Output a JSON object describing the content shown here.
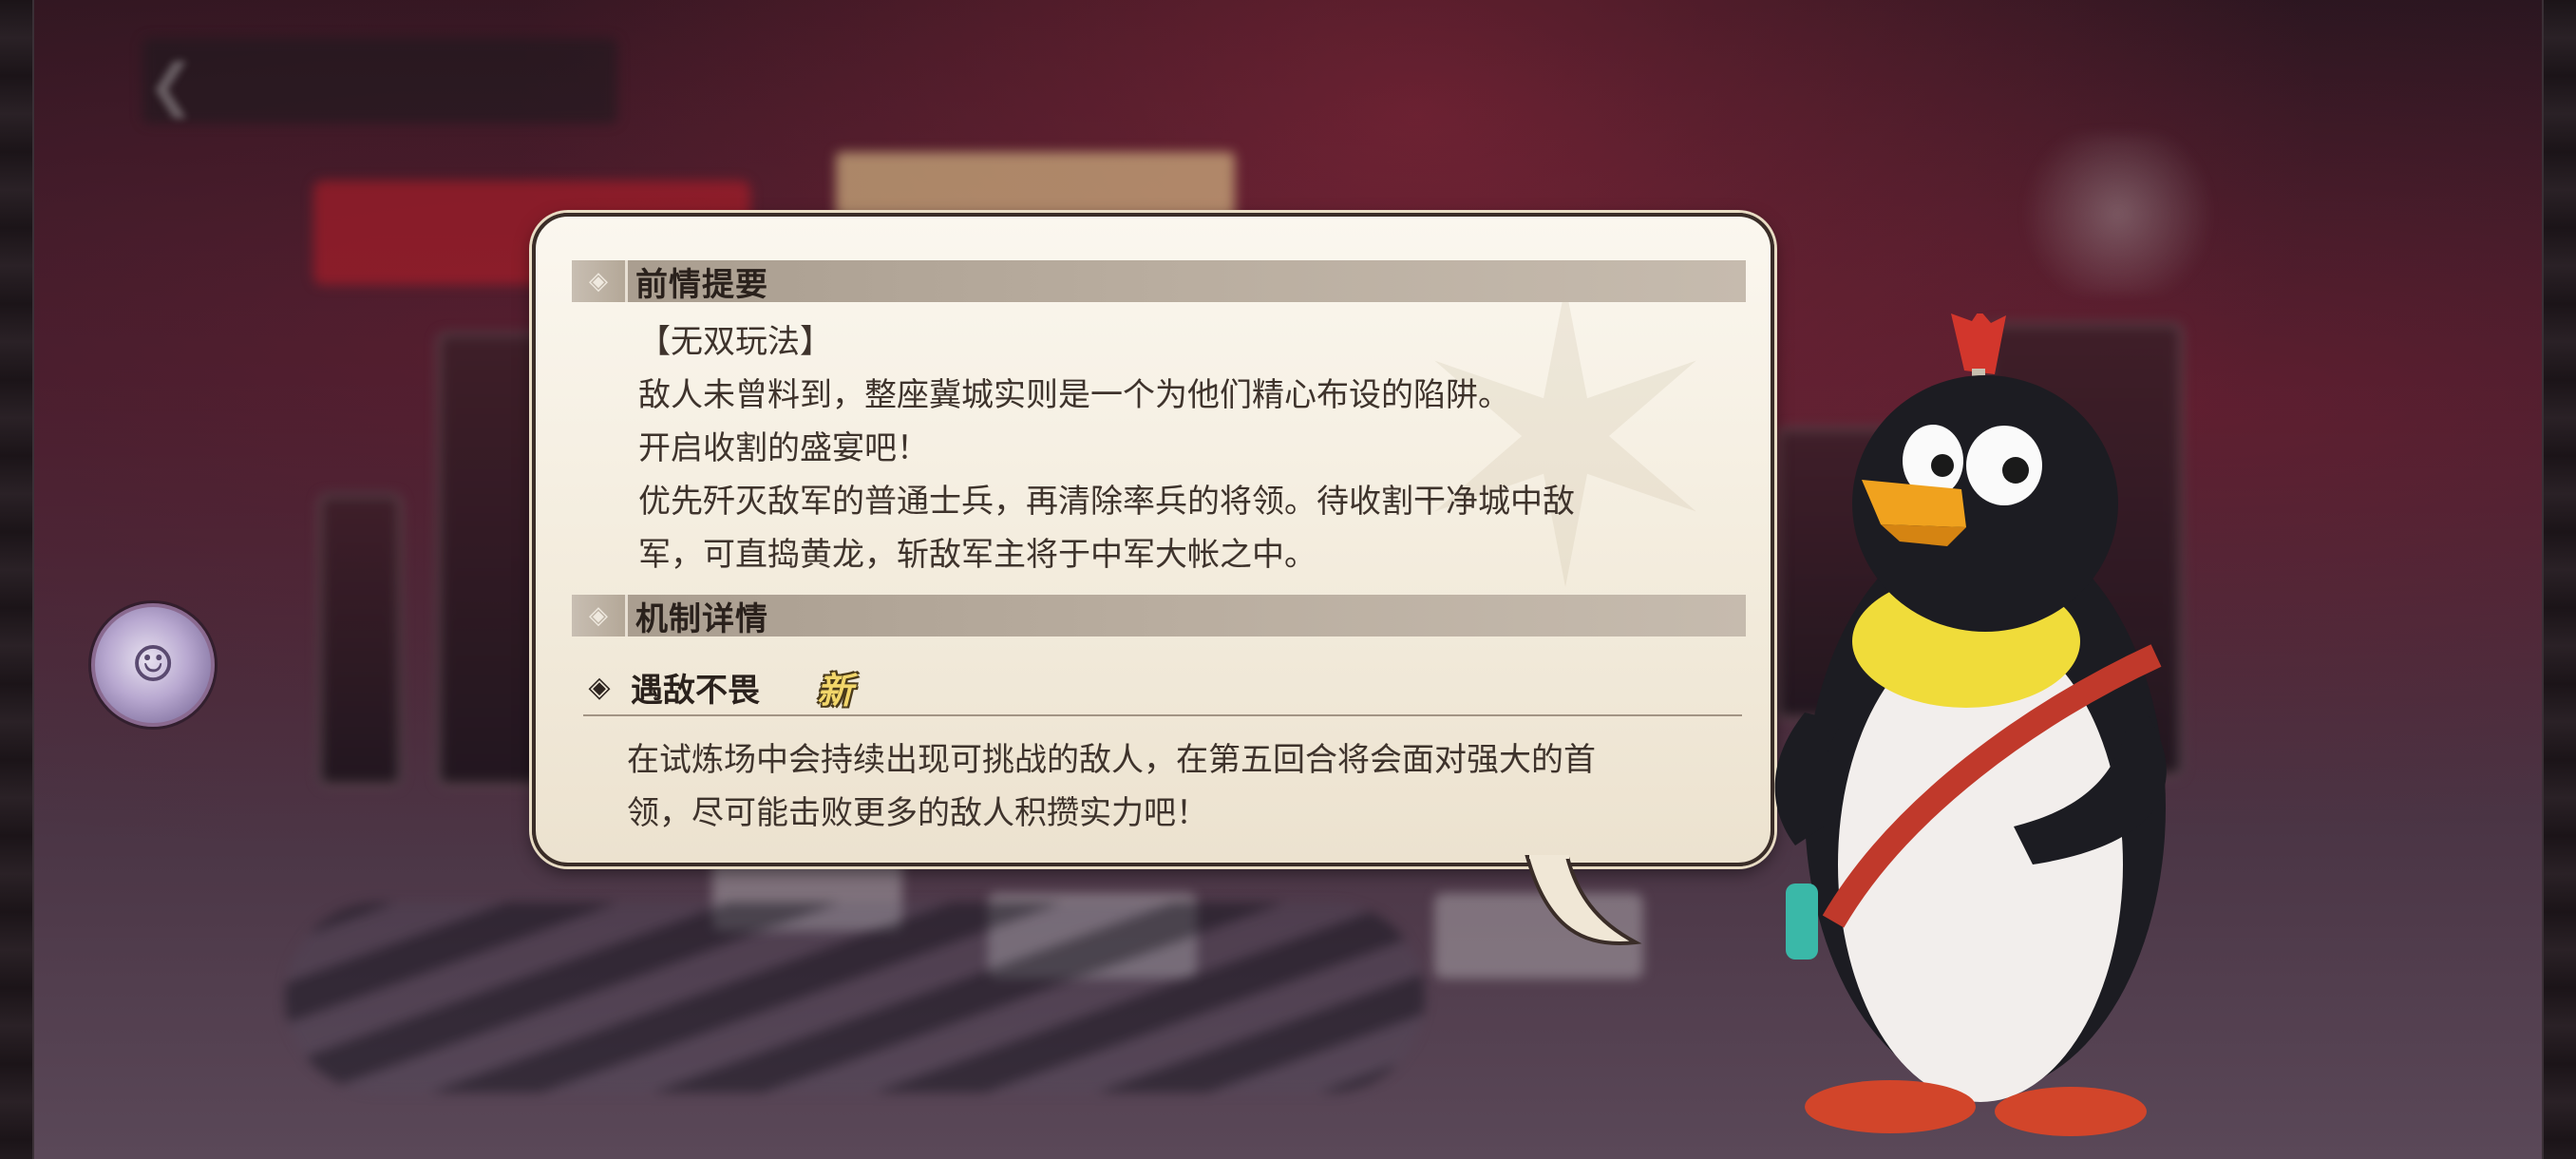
{
  "background": {
    "top_bar_icons": [
      "back-arrow-icon",
      "home-icon",
      "menu-icon"
    ]
  },
  "dialog": {
    "section1": {
      "title": "前情提要",
      "lines": [
        "【无双玩法】",
        "敌人未曾料到，整座冀城实则是一个为他们精心布设的陷阱。",
        "开启收割的盛宴吧！",
        "优先歼灭敌军的普通士兵，再清除率兵的将领。待收割干净城中敌",
        "军，可直捣黄龙，斩敌军主将于中军大帐之中。"
      ]
    },
    "section2": {
      "title": "机制详情",
      "mechanic": {
        "name": "遇敌不畏",
        "badge": "新",
        "desc_lines": [
          "在试炼场中会持续出现可挑战的敌人，在第五回合将会面对强大的首",
          "领，尽可能击败更多的敌人积攒实力吧！"
        ]
      }
    }
  },
  "colors": {
    "panel_bg": "#f3ecdd",
    "panel_border": "#3a2d28",
    "header_bar": "#b4a898",
    "new_badge": "#f2d66a"
  }
}
